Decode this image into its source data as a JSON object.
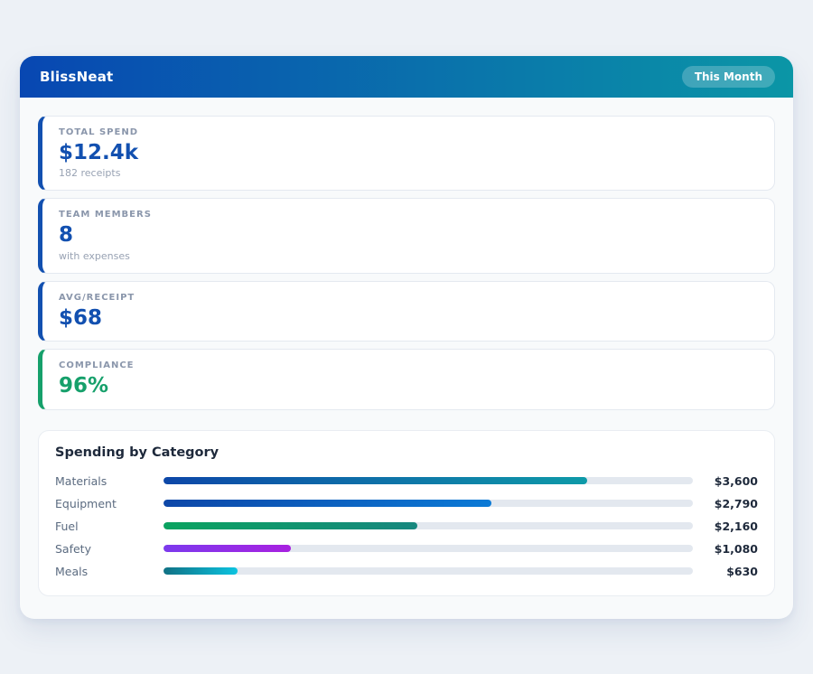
{
  "header": {
    "title": "BlissNeat",
    "badge": "This Month",
    "gradient_from": "#0847b2",
    "gradient_to": "#0b96a6"
  },
  "stats": [
    {
      "label": "TOTAL SPEND",
      "value": "$12.4k",
      "subtext": "182 receipts",
      "accent": "#1250b0"
    },
    {
      "label": "TEAM MEMBERS",
      "value": "8",
      "subtext": "with expenses",
      "accent": "#1250b0"
    },
    {
      "label": "AVG/RECEIPT",
      "value": "$68",
      "subtext": "",
      "accent": "#1250b0"
    },
    {
      "label": "COMPLIANCE",
      "value": "96%",
      "subtext": "",
      "accent": "#16a06b"
    }
  ],
  "chart": {
    "title": "Spending by Category",
    "track_color": "#e3e8ef",
    "rows": [
      {
        "label": "Materials",
        "display_value": "$3,600",
        "amount": 3600,
        "percent": 80,
        "gradient_from": "#0d47a8",
        "gradient_to": "#0e9aa8"
      },
      {
        "label": "Equipment",
        "display_value": "$2,790",
        "amount": 2790,
        "percent": 62,
        "gradient_from": "#0d47a8",
        "gradient_to": "#0b7ad6"
      },
      {
        "label": "Fuel",
        "display_value": "$2,160",
        "amount": 2160,
        "percent": 48,
        "gradient_from": "#0ba360",
        "gradient_to": "#17877f"
      },
      {
        "label": "Safety",
        "display_value": "$1,080",
        "amount": 1080,
        "percent": 24,
        "gradient_from": "#7c3aed",
        "gradient_to": "#a821e0"
      },
      {
        "label": "Meals",
        "display_value": "$630",
        "amount": 630,
        "percent": 14,
        "gradient_from": "#107184",
        "gradient_to": "#0cc3e0"
      }
    ]
  },
  "chart_data": {
    "type": "bar",
    "title": "Spending by Category",
    "categories": [
      "Materials",
      "Equipment",
      "Fuel",
      "Safety",
      "Meals"
    ],
    "values": [
      3600,
      2790,
      2160,
      1080,
      630
    ],
    "value_labels": [
      "$3,600",
      "$2,790",
      "$2,160",
      "$1,080",
      "$630"
    ],
    "orientation": "horizontal",
    "xlim": [
      0,
      4500
    ],
    "grid": false,
    "legend": false
  }
}
